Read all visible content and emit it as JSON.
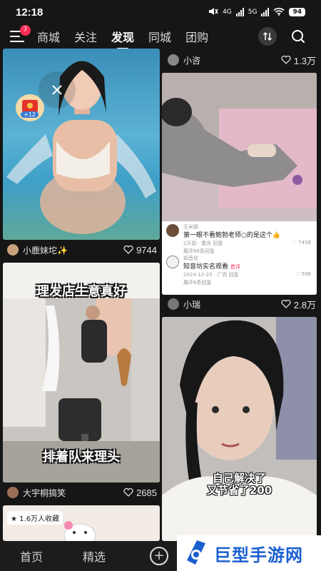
{
  "status_bar": {
    "time": "12:18",
    "network_a": "4G",
    "network_b": "5G",
    "battery": "94"
  },
  "nav": {
    "badge": "7",
    "tabs": [
      "商城",
      "关注",
      "发现",
      "同城",
      "团购"
    ],
    "active_tab": "发现"
  },
  "cards": {
    "left1": {
      "author": "小鹿妹坨✨",
      "likes": "9744",
      "red_packet": "+12"
    },
    "right1": {
      "author": "小咨",
      "likes": "1.3万",
      "comments": {
        "c1_user": "玉米肠",
        "c1_text": "第一眼不看鲍勃老师○的是这个👍",
        "c1_meta": "2天前 · 重庆   回复",
        "c1_likes": "7458",
        "c1_expand": "展开66条回复",
        "c2_user": "知音坊",
        "c2_text": "知音坊实名观看",
        "c2_tag": "首评",
        "c2_meta": "2024-12-25 · 广西   回复",
        "c2_likes": "598",
        "c2_expand": "展开6条回复"
      }
    },
    "left2": {
      "title": "理发店生意真好",
      "caption": "排着队来理头",
      "author": "大宇桐搞笑",
      "likes": "2685"
    },
    "right2": {
      "author": "小瑞",
      "likes": "2.8万",
      "caption_line1": "自己解决了",
      "caption_line2": "又节省了200"
    },
    "left3": {
      "collect": "1.6万人收藏"
    }
  },
  "bottom_bar": {
    "home": "首页",
    "featured": "精选",
    "plus": "+"
  },
  "watermark": {
    "text": "巨型手游网"
  }
}
